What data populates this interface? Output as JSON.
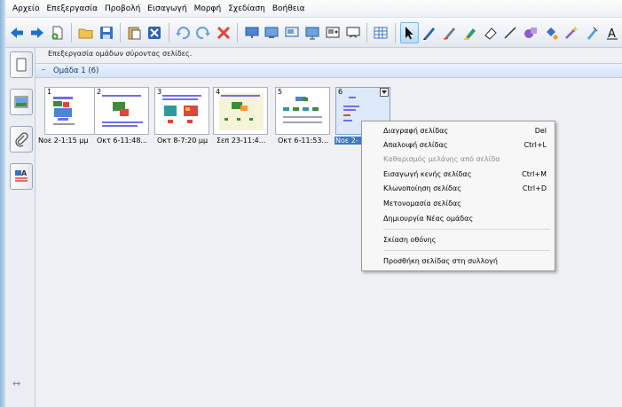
{
  "menubar": [
    "Αρχείο",
    "Επεξεργασία",
    "Προβολή",
    "Εισαγωγή",
    "Μορφή",
    "Σχεδίαση",
    "Βοήθεια"
  ],
  "toolbar": {
    "icons": [
      "back-arrow-icon",
      "forward-arrow-icon",
      "new-page-icon",
      "open-folder-icon",
      "save-icon",
      "paste-icon",
      "delete-page-icon",
      "undo-icon",
      "redo-icon",
      "delete-icon",
      "screen-shade-icon",
      "table-icon",
      "select-arrow-icon",
      "pen-icon",
      "creative-pen-icon",
      "highlighter-icon",
      "eraser-icon",
      "line-icon",
      "shape-icon",
      "fill-icon",
      "magic-pen-icon",
      "text-icon"
    ]
  },
  "sidebar": [
    "page-sorter-tab",
    "gallery-tab",
    "attachments-tab",
    "properties-tab"
  ],
  "content": {
    "hint": "Επεξεργασία ομάδων σύροντας σελίδες.",
    "group_title": "Ομάδα 1 (6)",
    "pages": [
      {
        "num": "1",
        "caption": "Νοε 2-1:15 μμ"
      },
      {
        "num": "2",
        "caption": "Οκτ 6-11:48..."
      },
      {
        "num": "3",
        "caption": "Οκτ 8-7:20 μμ"
      },
      {
        "num": "4",
        "caption": "Σεπ 23-11:4..."
      },
      {
        "num": "5",
        "caption": "Οκτ 6-11:53..."
      },
      {
        "num": "6",
        "caption": "Νοε 2-"
      }
    ]
  },
  "context_menu": {
    "items": [
      {
        "label": "Διαγραφή σελίδας",
        "shortcut": "Del",
        "enabled": true
      },
      {
        "label": "Απαλοιφή σελίδας",
        "shortcut": "Ctrl+L",
        "enabled": true
      },
      {
        "label": "Καθαρισμός μελάνης από σελίδα",
        "shortcut": "",
        "enabled": false
      },
      {
        "label": "Εισαγωγή κενής σελίδας",
        "shortcut": "Ctrl+M",
        "enabled": true
      },
      {
        "label": "Κλωνοποίηση σελίδας",
        "shortcut": "Ctrl+D",
        "enabled": true
      },
      {
        "label": "Μετονομασία σελίδας",
        "shortcut": "",
        "enabled": true
      },
      {
        "label": "Δημιουργία Νέας ομάδας",
        "shortcut": "",
        "enabled": true
      },
      {
        "label": "Σκίαση οθόνης",
        "shortcut": "",
        "enabled": true
      },
      {
        "label": "Προσθήκη σελίδας στη συλλογή",
        "shortcut": "",
        "enabled": true
      }
    ]
  }
}
